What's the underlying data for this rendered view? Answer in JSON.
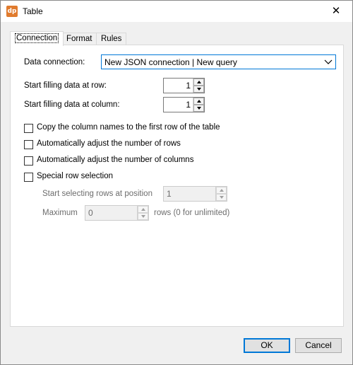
{
  "window": {
    "title": "Table",
    "app_icon_text": "dp",
    "close_glyph": "✕"
  },
  "tabs": [
    {
      "label": "Connection",
      "active": true
    },
    {
      "label": "Format",
      "active": false
    },
    {
      "label": "Rules",
      "active": false
    }
  ],
  "connection": {
    "data_connection_label": "Data connection:",
    "data_connection_value": "New JSON connection | New query",
    "start_row_label": "Start filling data at row:",
    "start_row_value": "1",
    "start_col_label": "Start filling data at column:",
    "start_col_value": "1"
  },
  "options": [
    {
      "label": "Copy the column names to the first row of the table",
      "checked": false
    },
    {
      "label": "Automatically adjust the number of rows",
      "checked": false
    },
    {
      "label": "Automatically adjust the number of columns",
      "checked": false
    },
    {
      "label": "Special row selection",
      "checked": false
    }
  ],
  "special_selection": {
    "start_position_label": "Start selecting rows at position",
    "start_position_value": "1",
    "maximum_label": "Maximum",
    "maximum_value": "0",
    "maximum_suffix": "rows (0 for unlimited)",
    "enabled": false
  },
  "buttons": {
    "ok": "OK",
    "cancel": "Cancel"
  },
  "colors": {
    "accent": "#0078d7",
    "app_icon": "#e07b2e",
    "disabled_text": "#6d6d6d"
  }
}
